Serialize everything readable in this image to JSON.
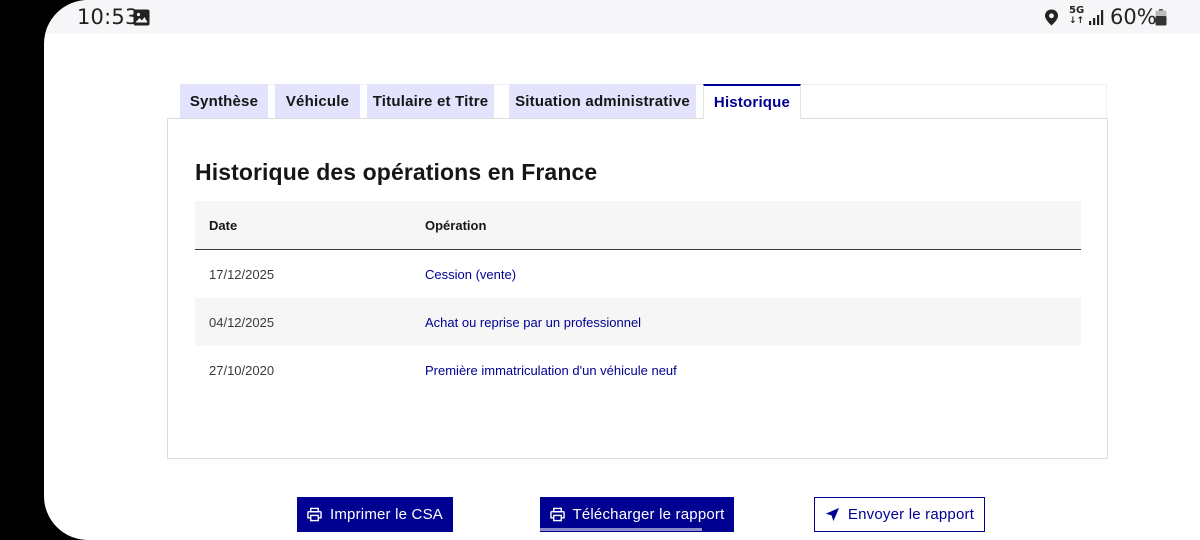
{
  "status_bar": {
    "time": "10:53",
    "network_top": "5G",
    "network_bottom": "↓↑",
    "battery": "60%",
    "icons": [
      "gallery-icon",
      "location-icon",
      "signal-icon",
      "battery-icon"
    ]
  },
  "tabs": [
    {
      "label": "Synthèse",
      "active": false
    },
    {
      "label": "Véhicule",
      "active": false
    },
    {
      "label": "Titulaire et Titre",
      "active": false
    },
    {
      "label": "Situation administrative",
      "active": false
    },
    {
      "label": "Historique",
      "active": true
    }
  ],
  "history": {
    "title": "Historique des opérations en France",
    "columns": [
      "Date",
      "Opération"
    ],
    "rows": [
      {
        "date": "17/12/2025",
        "operation": "Cession (vente)"
      },
      {
        "date": "04/12/2025",
        "operation": "Achat ou reprise par un professionnel"
      },
      {
        "date": "27/10/2020",
        "operation": "Première immatriculation d'un véhicule neuf"
      }
    ]
  },
  "actions": {
    "print_label": "Imprimer le CSA",
    "download_label": "Télécharger le rapport",
    "send_label": "Envoyer le rapport",
    "icons": [
      "printer-icon",
      "printer-icon",
      "send-icon"
    ]
  },
  "colors": {
    "accent": "#000091",
    "tab_background": "#e3e3fd",
    "row_alt": "#f6f6f6"
  }
}
